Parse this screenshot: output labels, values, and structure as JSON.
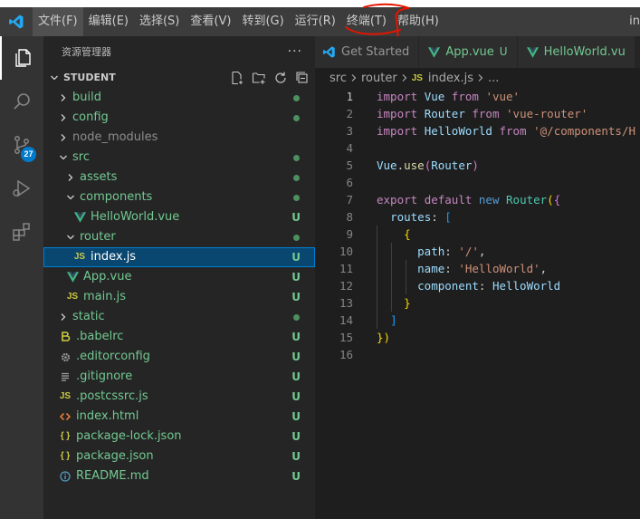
{
  "menubar": {
    "items": [
      "文件(F)",
      "编辑(E)",
      "选择(S)",
      "查看(V)",
      "转到(G)",
      "运行(R)",
      "终端(T)",
      "帮助(H)"
    ],
    "overflow_text": "in"
  },
  "activity": {
    "scm_badge": "27",
    "icons": [
      "explorer-icon",
      "search-icon",
      "source-control-icon",
      "run-debug-icon",
      "extensions-icon"
    ]
  },
  "sidebar": {
    "title": "资源管理器",
    "more": "···",
    "section": "STUDENT",
    "tree": [
      {
        "label": "build",
        "type": "folder",
        "expanded": false,
        "depth": 0,
        "status": "dot"
      },
      {
        "label": "config",
        "type": "folder",
        "expanded": false,
        "depth": 0,
        "status": "dot"
      },
      {
        "label": "node_modules",
        "type": "folder",
        "expanded": false,
        "depth": 0,
        "status": "",
        "dim": true
      },
      {
        "label": "src",
        "type": "folder",
        "expanded": true,
        "depth": 0,
        "status": "dot"
      },
      {
        "label": "assets",
        "type": "folder",
        "expanded": false,
        "depth": 1,
        "status": "dot"
      },
      {
        "label": "components",
        "type": "folder",
        "expanded": true,
        "depth": 1,
        "status": "dot"
      },
      {
        "label": "HelloWorld.vue",
        "type": "vue",
        "depth": 2,
        "status": "U"
      },
      {
        "label": "router",
        "type": "folder",
        "expanded": true,
        "depth": 1,
        "status": "dot"
      },
      {
        "label": "index.js",
        "type": "js",
        "depth": 2,
        "status": "U",
        "selected": true
      },
      {
        "label": "App.vue",
        "type": "vue",
        "depth": 1,
        "status": "U"
      },
      {
        "label": "main.js",
        "type": "js",
        "depth": 1,
        "status": "U"
      },
      {
        "label": "static",
        "type": "folder",
        "expanded": false,
        "depth": 0,
        "status": "dot"
      },
      {
        "label": ".babelrc",
        "type": "babel",
        "depth": 0,
        "status": "U"
      },
      {
        "label": ".editorconfig",
        "type": "gear",
        "depth": 0,
        "status": "U"
      },
      {
        "label": ".gitignore",
        "type": "lines",
        "depth": 0,
        "status": "U"
      },
      {
        "label": ".postcssrc.js",
        "type": "js",
        "depth": 0,
        "status": "U"
      },
      {
        "label": "index.html",
        "type": "html",
        "depth": 0,
        "status": "U"
      },
      {
        "label": "package-lock.json",
        "type": "json",
        "depth": 0,
        "status": "U"
      },
      {
        "label": "package.json",
        "type": "json",
        "depth": 0,
        "status": "U"
      },
      {
        "label": "README.md",
        "type": "info",
        "depth": 0,
        "status": "U"
      }
    ]
  },
  "tabs": [
    {
      "label": "Get Started",
      "icon": "vscode",
      "status": ""
    },
    {
      "label": "App.vue",
      "icon": "vue",
      "status": "U"
    },
    {
      "label": "HelloWorld.vu",
      "icon": "vue",
      "status": ""
    }
  ],
  "breadcrumb": {
    "parts": [
      "src",
      "router"
    ],
    "js_badge": "JS",
    "file": "index.js",
    "tail": "..."
  },
  "code": [
    [
      [
        "import",
        "kw2"
      ],
      [
        " ",
        "plain"
      ],
      [
        "Vue",
        "id"
      ],
      [
        " ",
        "plain"
      ],
      [
        "from",
        "kw2"
      ],
      [
        " ",
        "plain"
      ],
      [
        "'vue'",
        "str"
      ]
    ],
    [
      [
        "import",
        "kw2"
      ],
      [
        " ",
        "plain"
      ],
      [
        "Router",
        "id"
      ],
      [
        " ",
        "plain"
      ],
      [
        "from",
        "kw2"
      ],
      [
        " ",
        "plain"
      ],
      [
        "'vue-router'",
        "str"
      ]
    ],
    [
      [
        "import",
        "kw2"
      ],
      [
        " ",
        "plain"
      ],
      [
        "HelloWorld",
        "id"
      ],
      [
        " ",
        "plain"
      ],
      [
        "from",
        "kw2"
      ],
      [
        " ",
        "plain"
      ],
      [
        "'@/components/H",
        "str"
      ]
    ],
    [],
    [
      [
        "Vue",
        "id"
      ],
      [
        ".",
        "plain"
      ],
      [
        "use",
        "fn"
      ],
      [
        "(",
        "b2"
      ],
      [
        "Router",
        "id"
      ],
      [
        ")",
        "b2"
      ]
    ],
    [],
    [
      [
        "export",
        "kw2"
      ],
      [
        " ",
        "plain"
      ],
      [
        "default",
        "kw2"
      ],
      [
        " ",
        "plain"
      ],
      [
        "new",
        "kw"
      ],
      [
        " ",
        "plain"
      ],
      [
        "Router",
        "cls"
      ],
      [
        "(",
        "b1"
      ],
      [
        "{",
        "b2"
      ]
    ],
    [
      [
        "  ",
        "plain"
      ],
      [
        "routes",
        "id"
      ],
      [
        ": ",
        "plain"
      ],
      [
        "[",
        "b3"
      ]
    ],
    [
      [
        "    ",
        "plain"
      ],
      [
        "{",
        "b1"
      ]
    ],
    [
      [
        "      ",
        "plain"
      ],
      [
        "path",
        "id"
      ],
      [
        ": ",
        "plain"
      ],
      [
        "'/'",
        "str"
      ],
      [
        ",",
        "plain"
      ]
    ],
    [
      [
        "      ",
        "plain"
      ],
      [
        "name",
        "id"
      ],
      [
        ": ",
        "plain"
      ],
      [
        "'HelloWorld'",
        "str"
      ],
      [
        ",",
        "plain"
      ]
    ],
    [
      [
        "      ",
        "plain"
      ],
      [
        "component",
        "id"
      ],
      [
        ": ",
        "plain"
      ],
      [
        "HelloWorld",
        "id"
      ]
    ],
    [
      [
        "    ",
        "plain"
      ],
      [
        "}",
        "b1"
      ]
    ],
    [
      [
        "  ",
        "plain"
      ],
      [
        "]",
        "b3"
      ]
    ],
    [
      [
        "})",
        "b1"
      ]
    ],
    []
  ],
  "line_numbers": [
    "1",
    "2",
    "3",
    "4",
    "5",
    "6",
    "7",
    "8",
    "9",
    "10",
    "11",
    "12",
    "13",
    "14",
    "15",
    "16"
  ],
  "colors": {
    "accent": "#007acc",
    "untracked": "#73c991",
    "selection": "#094771",
    "vue": "#41b883",
    "js": "#cbcb41",
    "annotation": "#e51400"
  }
}
